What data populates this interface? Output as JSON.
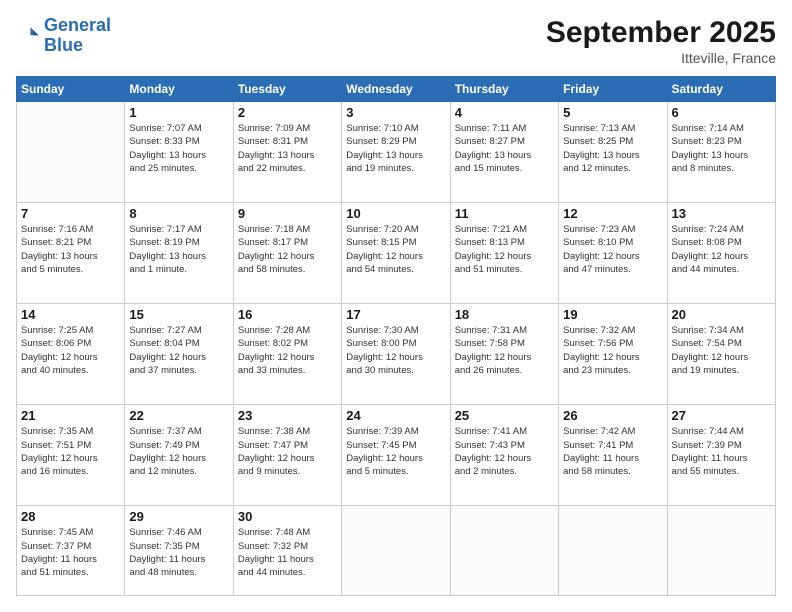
{
  "logo": {
    "line1": "General",
    "line2": "Blue"
  },
  "title": "September 2025",
  "location": "Itteville, France",
  "days_of_week": [
    "Sunday",
    "Monday",
    "Tuesday",
    "Wednesday",
    "Thursday",
    "Friday",
    "Saturday"
  ],
  "weeks": [
    [
      {
        "day": "",
        "info": ""
      },
      {
        "day": "1",
        "info": "Sunrise: 7:07 AM\nSunset: 8:33 PM\nDaylight: 13 hours\nand 25 minutes."
      },
      {
        "day": "2",
        "info": "Sunrise: 7:09 AM\nSunset: 8:31 PM\nDaylight: 13 hours\nand 22 minutes."
      },
      {
        "day": "3",
        "info": "Sunrise: 7:10 AM\nSunset: 8:29 PM\nDaylight: 13 hours\nand 19 minutes."
      },
      {
        "day": "4",
        "info": "Sunrise: 7:11 AM\nSunset: 8:27 PM\nDaylight: 13 hours\nand 15 minutes."
      },
      {
        "day": "5",
        "info": "Sunrise: 7:13 AM\nSunset: 8:25 PM\nDaylight: 13 hours\nand 12 minutes."
      },
      {
        "day": "6",
        "info": "Sunrise: 7:14 AM\nSunset: 8:23 PM\nDaylight: 13 hours\nand 8 minutes."
      }
    ],
    [
      {
        "day": "7",
        "info": "Sunrise: 7:16 AM\nSunset: 8:21 PM\nDaylight: 13 hours\nand 5 minutes."
      },
      {
        "day": "8",
        "info": "Sunrise: 7:17 AM\nSunset: 8:19 PM\nDaylight: 13 hours\nand 1 minute."
      },
      {
        "day": "9",
        "info": "Sunrise: 7:18 AM\nSunset: 8:17 PM\nDaylight: 12 hours\nand 58 minutes."
      },
      {
        "day": "10",
        "info": "Sunrise: 7:20 AM\nSunset: 8:15 PM\nDaylight: 12 hours\nand 54 minutes."
      },
      {
        "day": "11",
        "info": "Sunrise: 7:21 AM\nSunset: 8:13 PM\nDaylight: 12 hours\nand 51 minutes."
      },
      {
        "day": "12",
        "info": "Sunrise: 7:23 AM\nSunset: 8:10 PM\nDaylight: 12 hours\nand 47 minutes."
      },
      {
        "day": "13",
        "info": "Sunrise: 7:24 AM\nSunset: 8:08 PM\nDaylight: 12 hours\nand 44 minutes."
      }
    ],
    [
      {
        "day": "14",
        "info": "Sunrise: 7:25 AM\nSunset: 8:06 PM\nDaylight: 12 hours\nand 40 minutes."
      },
      {
        "day": "15",
        "info": "Sunrise: 7:27 AM\nSunset: 8:04 PM\nDaylight: 12 hours\nand 37 minutes."
      },
      {
        "day": "16",
        "info": "Sunrise: 7:28 AM\nSunset: 8:02 PM\nDaylight: 12 hours\nand 33 minutes."
      },
      {
        "day": "17",
        "info": "Sunrise: 7:30 AM\nSunset: 8:00 PM\nDaylight: 12 hours\nand 30 minutes."
      },
      {
        "day": "18",
        "info": "Sunrise: 7:31 AM\nSunset: 7:58 PM\nDaylight: 12 hours\nand 26 minutes."
      },
      {
        "day": "19",
        "info": "Sunrise: 7:32 AM\nSunset: 7:56 PM\nDaylight: 12 hours\nand 23 minutes."
      },
      {
        "day": "20",
        "info": "Sunrise: 7:34 AM\nSunset: 7:54 PM\nDaylight: 12 hours\nand 19 minutes."
      }
    ],
    [
      {
        "day": "21",
        "info": "Sunrise: 7:35 AM\nSunset: 7:51 PM\nDaylight: 12 hours\nand 16 minutes."
      },
      {
        "day": "22",
        "info": "Sunrise: 7:37 AM\nSunset: 7:49 PM\nDaylight: 12 hours\nand 12 minutes."
      },
      {
        "day": "23",
        "info": "Sunrise: 7:38 AM\nSunset: 7:47 PM\nDaylight: 12 hours\nand 9 minutes."
      },
      {
        "day": "24",
        "info": "Sunrise: 7:39 AM\nSunset: 7:45 PM\nDaylight: 12 hours\nand 5 minutes."
      },
      {
        "day": "25",
        "info": "Sunrise: 7:41 AM\nSunset: 7:43 PM\nDaylight: 12 hours\nand 2 minutes."
      },
      {
        "day": "26",
        "info": "Sunrise: 7:42 AM\nSunset: 7:41 PM\nDaylight: 11 hours\nand 58 minutes."
      },
      {
        "day": "27",
        "info": "Sunrise: 7:44 AM\nSunset: 7:39 PM\nDaylight: 11 hours\nand 55 minutes."
      }
    ],
    [
      {
        "day": "28",
        "info": "Sunrise: 7:45 AM\nSunset: 7:37 PM\nDaylight: 11 hours\nand 51 minutes."
      },
      {
        "day": "29",
        "info": "Sunrise: 7:46 AM\nSunset: 7:35 PM\nDaylight: 11 hours\nand 48 minutes."
      },
      {
        "day": "30",
        "info": "Sunrise: 7:48 AM\nSunset: 7:32 PM\nDaylight: 11 hours\nand 44 minutes."
      },
      {
        "day": "",
        "info": ""
      },
      {
        "day": "",
        "info": ""
      },
      {
        "day": "",
        "info": ""
      },
      {
        "day": "",
        "info": ""
      }
    ]
  ]
}
